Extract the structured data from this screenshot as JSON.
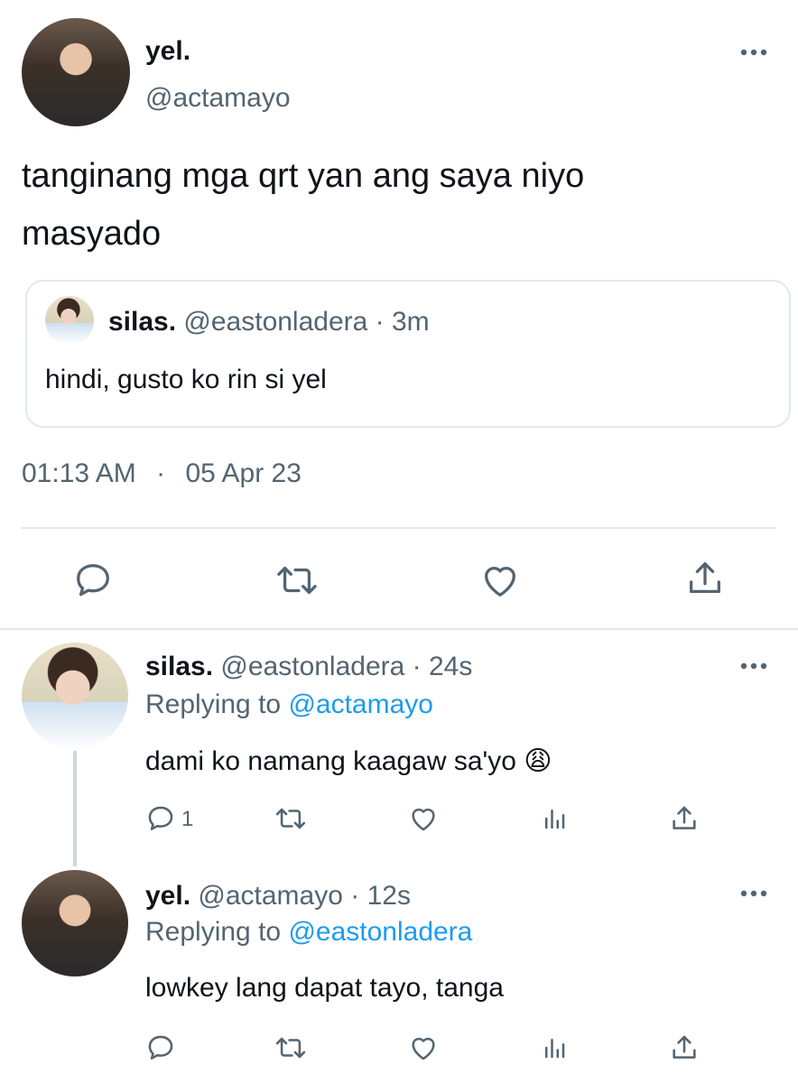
{
  "main_tweet": {
    "author_name": "yel.",
    "author_handle": "@actamayo",
    "more_icon": "more-dots-icon",
    "text_line1": "tanginang mga qrt yan ang saya niyo",
    "text_line2": "masyado",
    "quoted": {
      "author_name": "silas.",
      "author_handle": "@eastonladera",
      "time": "· 3m",
      "text": "hindi, gusto ko rin si yel"
    },
    "time": "01:13 AM",
    "dot": "·",
    "date": "05 Apr 23",
    "actions": [
      "reply-icon",
      "retweet-icon",
      "like-icon",
      "share-icon"
    ]
  },
  "replies": [
    {
      "author_name": "silas.",
      "author_handle": "@eastonladera",
      "time": "· 24s",
      "replying_prefix": "Replying to ",
      "replying_to": "@actamayo",
      "text": "dami ko namang kaagaw sa'yo 😩",
      "reply_count": "1"
    },
    {
      "author_name": "yel.",
      "author_handle": "@actamayo",
      "time": "· 12s",
      "replying_prefix": "Replying to ",
      "replying_to": "@eastonladera",
      "text": "lowkey lang dapat tayo, tanga",
      "reply_count": ""
    }
  ],
  "colors": {
    "text": "#0f1419",
    "muted": "#536471",
    "link": "#1d9bf0",
    "border": "#e1e8ed",
    "thread_line": "#cfd9de"
  }
}
